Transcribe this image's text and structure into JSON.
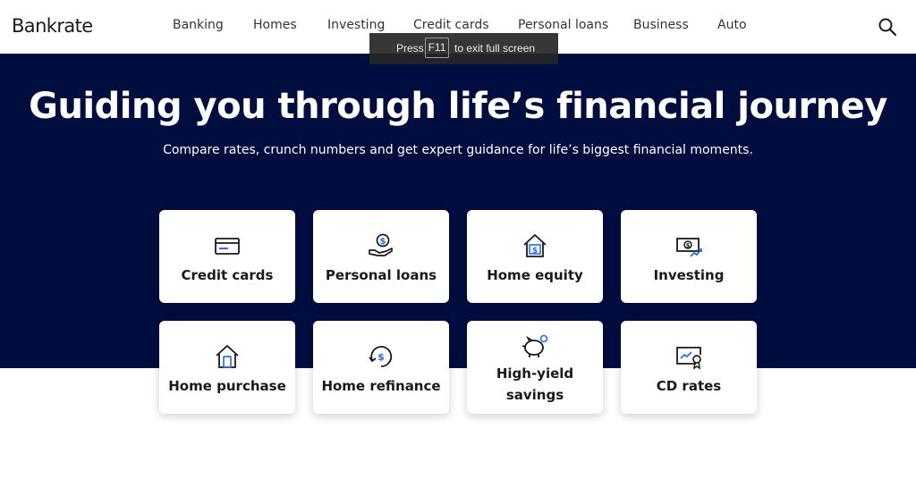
{
  "header": {
    "logo": "Bankrate",
    "nav": [
      {
        "label": "Banking"
      },
      {
        "label": "Homes"
      },
      {
        "label": "Investing"
      },
      {
        "label": "Credit cards"
      },
      {
        "label": "Personal loans"
      },
      {
        "label": "Business"
      },
      {
        "label": "Auto"
      }
    ],
    "search_icon": "search-icon"
  },
  "hero": {
    "title": "Guiding you through life’s financial journey",
    "subtitle": "Compare rates, crunch numbers and get expert guidance for life’s biggest financial moments."
  },
  "cards": [
    {
      "label": "Credit cards",
      "icon": "credit-card-icon"
    },
    {
      "label": "Personal loans",
      "icon": "hand-dollar-icon"
    },
    {
      "label": "Home equity",
      "icon": "house-dollar-icon"
    },
    {
      "label": "Investing",
      "icon": "bill-growth-icon"
    },
    {
      "label": "Home purchase",
      "icon": "house-phone-icon"
    },
    {
      "label": "Home refinance",
      "icon": "dollar-refresh-icon"
    },
    {
      "label": "High-yield savings",
      "icon": "piggy-bank-icon"
    },
    {
      "label": "CD rates",
      "icon": "certificate-icon"
    }
  ],
  "fullscreen_toast": {
    "prefix": "Press",
    "key": "F11",
    "suffix": "to exit full screen"
  },
  "colors": {
    "hero_bg": "#000d3f",
    "icon_blue": "#2b6ee6",
    "text_dark": "#1a1a1a"
  }
}
